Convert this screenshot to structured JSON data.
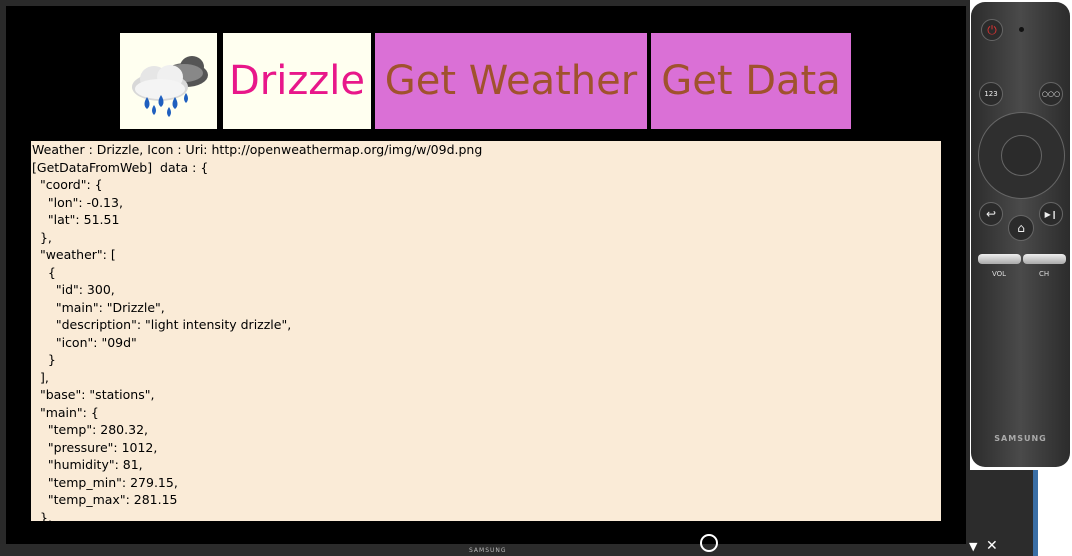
{
  "app": {
    "condition_label": "Drizzle",
    "get_weather_label": "Get Weather",
    "get_data_label": "Get Data",
    "icon_name": "weather-drizzle-icon"
  },
  "output_text": "Weather : Drizzle, Icon : Uri: http://openweathermap.org/img/w/09d.png\n[GetDataFromWeb]  data : {\n  \"coord\": {\n    \"lon\": -0.13,\n    \"lat\": 51.51\n  },\n  \"weather\": [\n    {\n      \"id\": 300,\n      \"main\": \"Drizzle\",\n      \"description\": \"light intensity drizzle\",\n      \"icon\": \"09d\"\n    }\n  ],\n  \"base\": \"stations\",\n  \"main\": {\n    \"temp\": 280.32,\n    \"pressure\": 1012,\n    \"humidity\": 81,\n    \"temp_min\": 279.15,\n    \"temp_max\": 281.15\n  },",
  "tv": {
    "brand": "SAMSUNG"
  },
  "remote": {
    "brand": "SAMSUNG",
    "btn_123": "123",
    "btn_more": "○○○",
    "vol_label": "VOL",
    "ch_label": "CH"
  },
  "colors": {
    "condition_text": "#e8178a",
    "button_bg": "#da70d6",
    "button_text": "#a0522d",
    "tile_bg": "#fffff0",
    "output_bg": "#faebd7"
  }
}
